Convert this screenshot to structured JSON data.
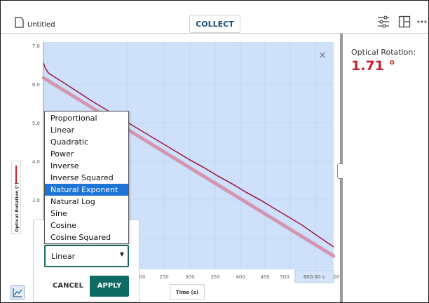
{
  "header": {
    "doc_title": "Untitled",
    "collect_label": "COLLECT"
  },
  "toolbar_icons": [
    "sliders-icon",
    "layout-icon",
    "more-icon"
  ],
  "meter": {
    "label": "Optical Rotation:",
    "value": "1.71 °",
    "value_color": "#c8202d"
  },
  "graph": {
    "close_glyph": "×",
    "ylabel": "Optical Rotation (°)",
    "xlabel": "Time (s)",
    "y_ticks": [
      "7.0",
      "6.0",
      "5.0",
      "4.0",
      "3.0"
    ],
    "x_ticks": [
      "00",
      "250",
      "300",
      "350",
      "400",
      "450",
      "500"
    ],
    "x_range_label": "600.00 s",
    "x_tick_right_partial": "00",
    "selection_color": "#cfe0fb",
    "data_color": "#9b1f45",
    "fit_color": "#d48aa4"
  },
  "fit_menu": {
    "options": [
      "Proportional",
      "Linear",
      "Quadratic",
      "Power",
      "Inverse",
      "Inverse Squared",
      "Natural Exponent",
      "Natural Log",
      "Sine",
      "Cosine",
      "Cosine Squared"
    ],
    "highlighted": "Natural Exponent",
    "selected_value": "Linear",
    "cancel_label": "CANCEL",
    "apply_label": "APPLY",
    "accent": "#0d6b63"
  }
}
